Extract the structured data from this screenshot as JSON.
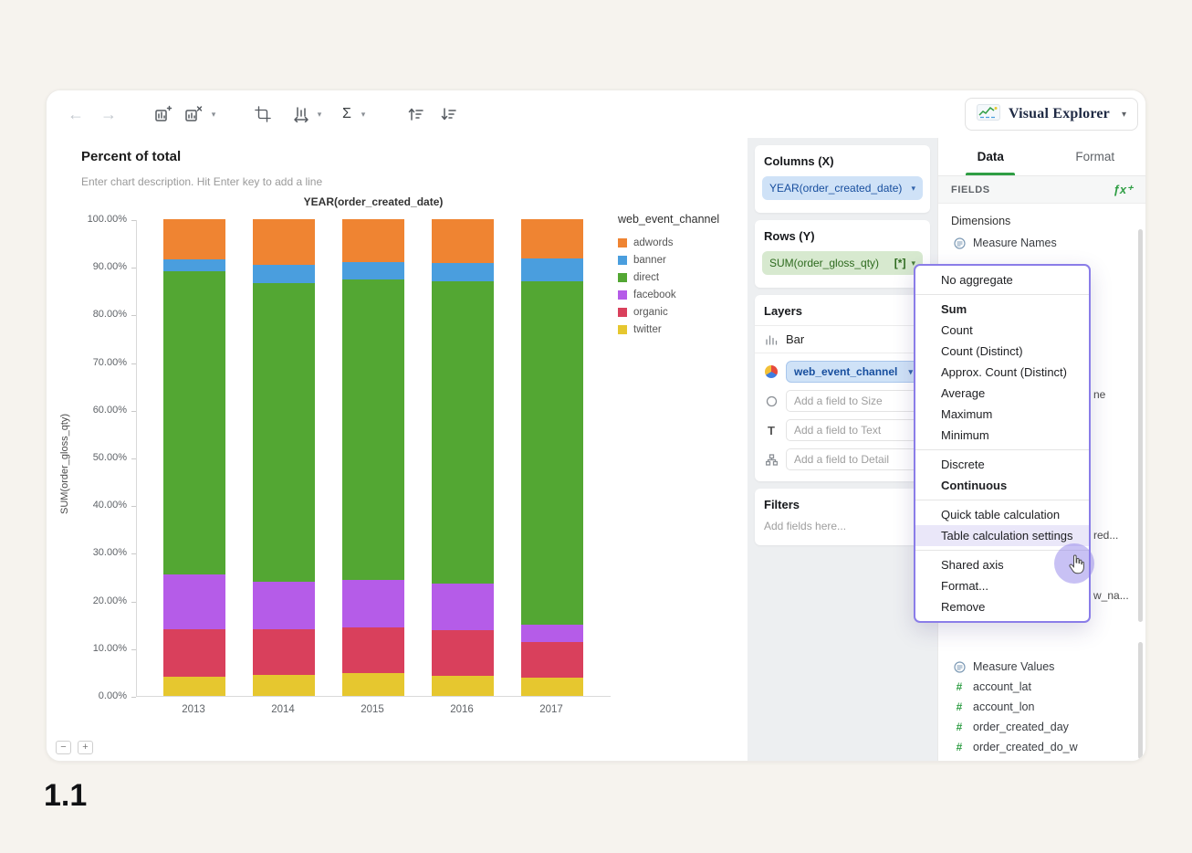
{
  "page_label": "1.1",
  "brand": {
    "label": "Visual Explorer"
  },
  "glyphs": {
    "back": "←",
    "forward": "→",
    "sigma": "Σ",
    "caret": "▾",
    "minus": "−",
    "plus": "+",
    "text_icon": "T"
  },
  "chart": {
    "title": "Percent of total",
    "description": "Enter chart description. Hit Enter key to add a line",
    "top_axis_label": "YEAR(order_created_date)",
    "y_axis_label": "SUM(order_gloss_qty)"
  },
  "chart_data": {
    "type": "bar",
    "stacked": true,
    "percent_of_total": true,
    "title": "YEAR(order_created_date)",
    "xlabel": "YEAR(order_created_date)",
    "ylabel": "SUM(order_gloss_qty)",
    "categories": [
      "2013",
      "2014",
      "2015",
      "2016",
      "2017"
    ],
    "series": [
      {
        "name": "twitter",
        "color": "#e6c72f",
        "values": [
          4.0,
          4.5,
          4.8,
          4.3,
          3.8
        ]
      },
      {
        "name": "organic",
        "color": "#d9405c",
        "values": [
          10.0,
          9.5,
          9.5,
          9.5,
          7.5
        ]
      },
      {
        "name": "facebook",
        "color": "#b55ce8",
        "values": [
          11.5,
          10.0,
          10.0,
          9.7,
          3.7
        ]
      },
      {
        "name": "direct",
        "color": "#53a733",
        "values": [
          63.5,
          62.5,
          63.0,
          63.5,
          72.0
        ]
      },
      {
        "name": "banner",
        "color": "#4a9ede",
        "values": [
          2.5,
          4.0,
          3.7,
          3.8,
          4.8
        ]
      },
      {
        "name": "adwords",
        "color": "#ef8432",
        "values": [
          8.5,
          9.5,
          9.0,
          9.2,
          8.2
        ]
      }
    ],
    "legend": {
      "title": "web_event_channel",
      "position": "right",
      "entries": [
        {
          "label": "adwords",
          "color": "#ef8432"
        },
        {
          "label": "banner",
          "color": "#4a9ede"
        },
        {
          "label": "direct",
          "color": "#53a733"
        },
        {
          "label": "facebook",
          "color": "#b55ce8"
        },
        {
          "label": "organic",
          "color": "#d9405c"
        },
        {
          "label": "twitter",
          "color": "#e6c72f"
        }
      ]
    },
    "ylim": [
      0,
      100
    ],
    "yticks": [
      "0.00%",
      "10.00%",
      "20.00%",
      "30.00%",
      "40.00%",
      "50.00%",
      "60.00%",
      "70.00%",
      "80.00%",
      "90.00%",
      "100.00%"
    ],
    "grid": false
  },
  "shelves": {
    "columns": {
      "title": "Columns (X)",
      "pill": "YEAR(order_created_date)"
    },
    "rows": {
      "title": "Rows (Y)",
      "pill": "SUM(order_gloss_qty)",
      "badge": "[*]"
    },
    "layers": {
      "title": "Layers",
      "mark_type": "Bar",
      "color_field": "web_event_channel",
      "size_placeholder": "Add a field to Size",
      "text_placeholder": "Add a field to Text",
      "detail_placeholder": "Add a field to Detail"
    },
    "filters": {
      "title": "Filters",
      "placeholder": "Add fields here..."
    }
  },
  "fields_panel": {
    "tabs": [
      {
        "label": "Data",
        "active": true
      },
      {
        "label": "Format",
        "active": false
      }
    ],
    "section_label": "FIELDS",
    "fx_label": "ƒx⁺",
    "dimensions_label": "Dimensions",
    "dimension_items": [
      {
        "label": "Measure Names",
        "icon": "measure-names"
      }
    ],
    "occluded_fragments": [
      "ne",
      "red...",
      "w_na..."
    ],
    "measure_items": [
      {
        "label": "Measure Values",
        "icon": "measure-values"
      },
      {
        "label": "account_lat",
        "icon": "number"
      },
      {
        "label": "account_lon",
        "icon": "number"
      },
      {
        "label": "order_created_day",
        "icon": "number"
      },
      {
        "label": "order_created_do_w",
        "icon": "number"
      }
    ]
  },
  "context_menu": {
    "items": [
      {
        "label": "No aggregate"
      },
      {
        "divider": true
      },
      {
        "label": "Sum",
        "bold": true
      },
      {
        "label": "Count"
      },
      {
        "label": "Count (Distinct)"
      },
      {
        "label": "Approx. Count (Distinct)"
      },
      {
        "label": "Average"
      },
      {
        "label": "Maximum"
      },
      {
        "label": "Minimum"
      },
      {
        "divider": true
      },
      {
        "label": "Discrete"
      },
      {
        "label": "Continuous",
        "bold": true
      },
      {
        "divider": true
      },
      {
        "label": "Quick table calculation"
      },
      {
        "label": "Table calculation settings",
        "highlighted": true
      },
      {
        "divider": true
      },
      {
        "label": "Shared axis"
      },
      {
        "label": "Format..."
      },
      {
        "label": "Remove"
      }
    ]
  },
  "colors": {
    "accent_green": "#2f9e44",
    "pill_blue_bg": "#cfe2f7",
    "pill_blue_text": "#174e9e",
    "pill_green_bg": "#d7e9cf",
    "pill_green_text": "#2d6a1e",
    "menu_border": "#8a7de8",
    "cursor_highlight": "rgba(140,126,232,0.48)"
  }
}
